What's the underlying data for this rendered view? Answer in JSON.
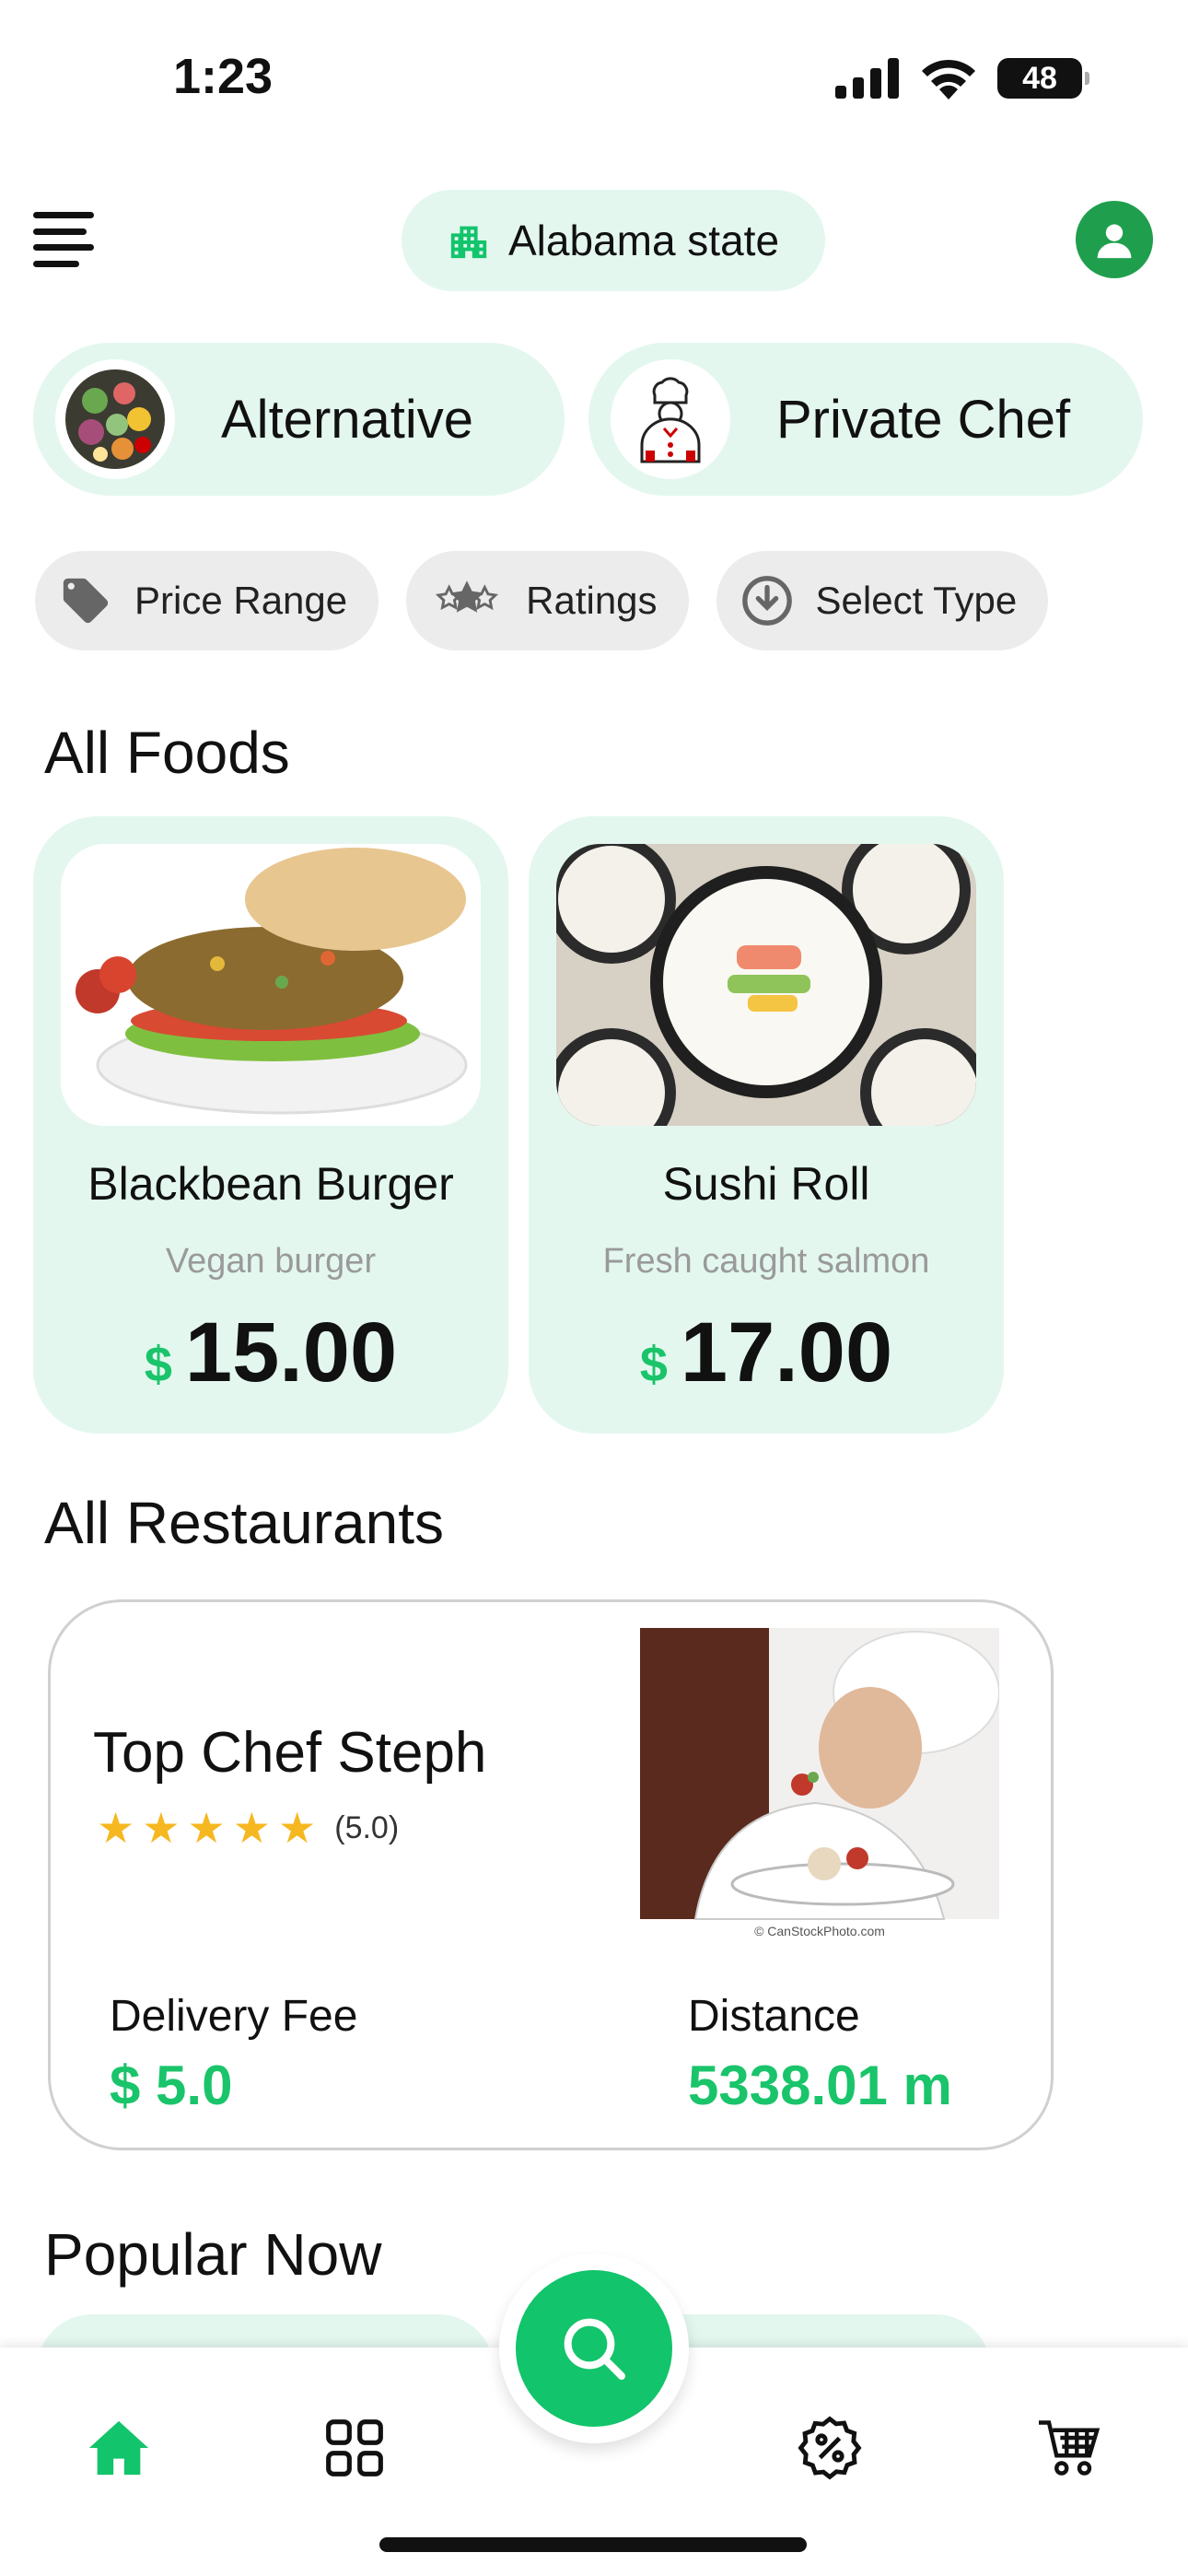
{
  "status_bar": {
    "time": "1:23",
    "battery": "48"
  },
  "header": {
    "location": "Alabama state"
  },
  "categories": [
    {
      "label": "Alternative",
      "icon": "vegetables-icon"
    },
    {
      "label": "Private Chef",
      "icon": "chef-icon"
    }
  ],
  "filters": [
    {
      "label": "Price Range",
      "icon": "tag-icon"
    },
    {
      "label": "Ratings",
      "icon": "stars-icon"
    },
    {
      "label": "Select Type",
      "icon": "download-circle-icon"
    }
  ],
  "sections": {
    "all_foods": "All Foods",
    "all_restaurants": "All Restaurants",
    "popular_now": "Popular Now"
  },
  "foods": [
    {
      "name": "Blackbean Burger",
      "description": "Vegan burger",
      "currency": "$",
      "price": "15.00"
    },
    {
      "name": "Sushi Roll",
      "description": "Fresh caught salmon",
      "currency": "$",
      "price": "17.00"
    }
  ],
  "restaurant": {
    "name": "Top Chef Steph",
    "rating": 5,
    "rating_text": "(5.0)",
    "image_caption": "© CanStockPhoto.com",
    "delivery_fee_label": "Delivery Fee",
    "delivery_fee_value": "$ 5.0",
    "distance_label": "Distance",
    "distance_value": "5338.01 m"
  },
  "colors": {
    "accent": "#12c46b",
    "pill_bg": "#e3f7ef",
    "star": "#f6b820",
    "profile": "#1f9f4d"
  },
  "bottom_nav": [
    "home-icon",
    "grid-icon",
    "search-icon",
    "discount-icon",
    "cart-icon"
  ]
}
